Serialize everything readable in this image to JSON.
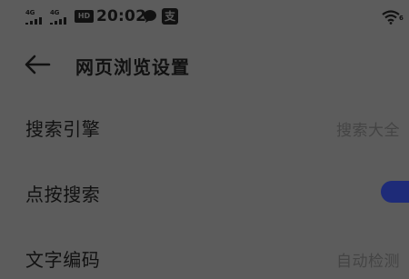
{
  "status_bar": {
    "network_1": "4G",
    "network_2": "4G",
    "hd_badge": "HD",
    "time": "20:02",
    "notif_icon_text": "支",
    "wifi_label": "6",
    "icons": [
      "signal-icon",
      "signal-icon",
      "hd-icon",
      "chat-bubble-icon",
      "alipay-icon",
      "wifi-icon"
    ]
  },
  "header": {
    "title": "网页浏览设置",
    "back_icon": "back-arrow-icon"
  },
  "settings": {
    "search_engine": {
      "label": "搜索引擎",
      "value": "搜索大全"
    },
    "tap_search": {
      "label": "点按搜索",
      "enabled": true,
      "accent": "#1e2b78"
    },
    "text_encoding": {
      "label": "文字编码",
      "value": "自动检测"
    }
  }
}
